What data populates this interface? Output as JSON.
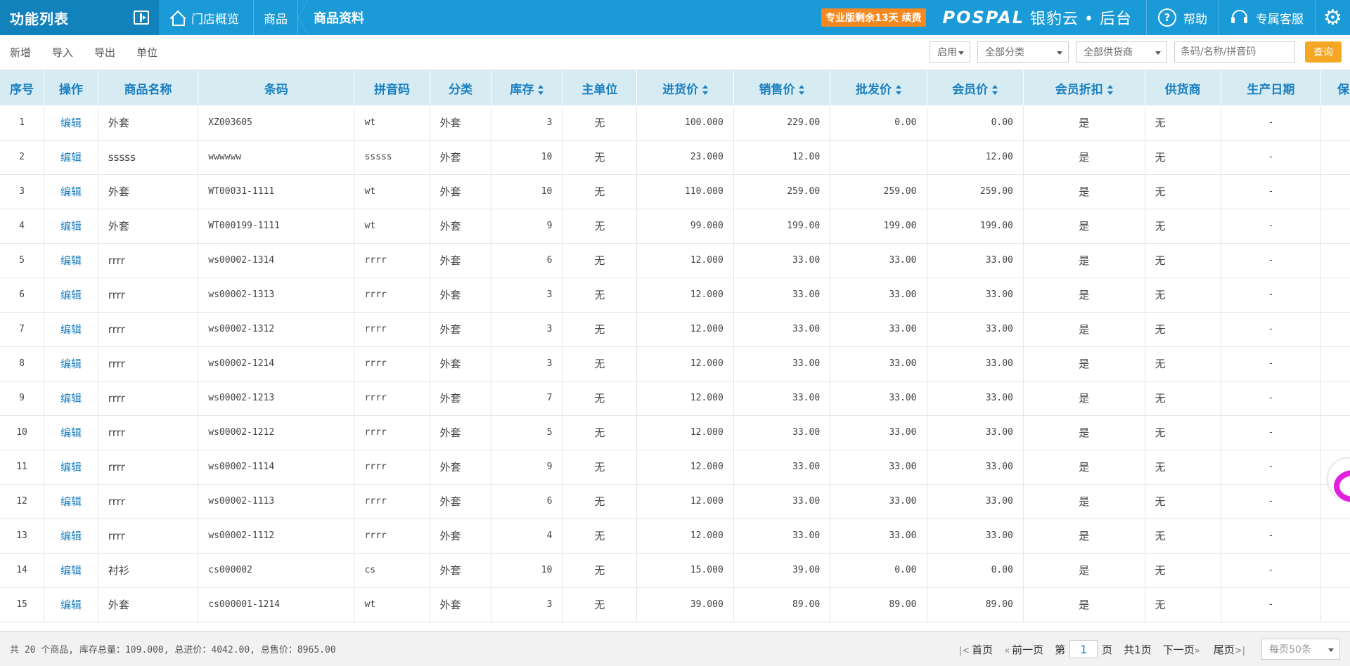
{
  "topbar": {
    "menu_title": "功能列表",
    "breadcrumb_home": "门店概览",
    "breadcrumb_parent": "商品",
    "breadcrumb_current": "商品资料",
    "renew_text": "专业版剩余13天 续费",
    "logo_text": "POSPAL",
    "logo_cn": "银豹云 • 后台",
    "help_label": "帮助",
    "service_label": "专属客服",
    "colors": {
      "bar": "#1a9ad6",
      "brand_block": "#1282bd",
      "renew": "#f5891f"
    }
  },
  "toolbar": {
    "actions": [
      "新增",
      "导入",
      "导出",
      "单位"
    ],
    "status_select": "启用",
    "category_select": "全部分类",
    "supplier_select": "全部供货商",
    "search_placeholder": "条码/名称/拼音码",
    "query_label": "查询",
    "colors": {
      "query": "#f5a623"
    }
  },
  "table": {
    "headers": [
      "序号",
      "操作",
      "商品名称",
      "条码",
      "拼音码",
      "分类",
      "库存",
      "主单位",
      "进货价",
      "销售价",
      "批发价",
      "会员价",
      "会员折扣",
      "供货商",
      "生产日期",
      "保质"
    ],
    "sortable": [
      "库存",
      "进货价",
      "销售价",
      "批发价",
      "会员价",
      "会员折扣"
    ],
    "edit_label": "编辑",
    "rows": [
      {
        "no": "1",
        "name": "外套",
        "barcode": "XZ003605",
        "pinyin": "wt",
        "category": "外套",
        "stock": "3",
        "unit": "无",
        "purchase": "100.000",
        "sale": "229.00",
        "wholesale": "0.00",
        "member": "0.00",
        "discount": "是",
        "supplier": "无",
        "date": "-"
      },
      {
        "no": "2",
        "name": "sssss",
        "barcode": "wwwwww",
        "pinyin": "sssss",
        "category": "外套",
        "stock": "10",
        "unit": "无",
        "purchase": "23.000",
        "sale": "12.00",
        "wholesale": "",
        "member": "12.00",
        "discount": "是",
        "supplier": "无",
        "date": "-"
      },
      {
        "no": "3",
        "name": "外套",
        "barcode": "WT00031-1111",
        "pinyin": "wt",
        "category": "外套",
        "stock": "10",
        "unit": "无",
        "purchase": "110.000",
        "sale": "259.00",
        "wholesale": "259.00",
        "member": "259.00",
        "discount": "是",
        "supplier": "无",
        "date": "-"
      },
      {
        "no": "4",
        "name": "外套",
        "barcode": "WT000199-1111",
        "pinyin": "wt",
        "category": "外套",
        "stock": "9",
        "unit": "无",
        "purchase": "99.000",
        "sale": "199.00",
        "wholesale": "199.00",
        "member": "199.00",
        "discount": "是",
        "supplier": "无",
        "date": "-"
      },
      {
        "no": "5",
        "name": "rrrr",
        "barcode": "ws00002-1314",
        "pinyin": "rrrr",
        "category": "外套",
        "stock": "6",
        "unit": "无",
        "purchase": "12.000",
        "sale": "33.00",
        "wholesale": "33.00",
        "member": "33.00",
        "discount": "是",
        "supplier": "无",
        "date": "-"
      },
      {
        "no": "6",
        "name": "rrrr",
        "barcode": "ws00002-1313",
        "pinyin": "rrrr",
        "category": "外套",
        "stock": "3",
        "unit": "无",
        "purchase": "12.000",
        "sale": "33.00",
        "wholesale": "33.00",
        "member": "33.00",
        "discount": "是",
        "supplier": "无",
        "date": "-"
      },
      {
        "no": "7",
        "name": "rrrr",
        "barcode": "ws00002-1312",
        "pinyin": "rrrr",
        "category": "外套",
        "stock": "3",
        "unit": "无",
        "purchase": "12.000",
        "sale": "33.00",
        "wholesale": "33.00",
        "member": "33.00",
        "discount": "是",
        "supplier": "无",
        "date": "-"
      },
      {
        "no": "8",
        "name": "rrrr",
        "barcode": "ws00002-1214",
        "pinyin": "rrrr",
        "category": "外套",
        "stock": "3",
        "unit": "无",
        "purchase": "12.000",
        "sale": "33.00",
        "wholesale": "33.00",
        "member": "33.00",
        "discount": "是",
        "supplier": "无",
        "date": "-"
      },
      {
        "no": "9",
        "name": "rrrr",
        "barcode": "ws00002-1213",
        "pinyin": "rrrr",
        "category": "外套",
        "stock": "7",
        "unit": "无",
        "purchase": "12.000",
        "sale": "33.00",
        "wholesale": "33.00",
        "member": "33.00",
        "discount": "是",
        "supplier": "无",
        "date": "-"
      },
      {
        "no": "10",
        "name": "rrrr",
        "barcode": "ws00002-1212",
        "pinyin": "rrrr",
        "category": "外套",
        "stock": "5",
        "unit": "无",
        "purchase": "12.000",
        "sale": "33.00",
        "wholesale": "33.00",
        "member": "33.00",
        "discount": "是",
        "supplier": "无",
        "date": "-"
      },
      {
        "no": "11",
        "name": "rrrr",
        "barcode": "ws00002-1114",
        "pinyin": "rrrr",
        "category": "外套",
        "stock": "9",
        "unit": "无",
        "purchase": "12.000",
        "sale": "33.00",
        "wholesale": "33.00",
        "member": "33.00",
        "discount": "是",
        "supplier": "无",
        "date": "-"
      },
      {
        "no": "12",
        "name": "rrrr",
        "barcode": "ws00002-1113",
        "pinyin": "rrrr",
        "category": "外套",
        "stock": "6",
        "unit": "无",
        "purchase": "12.000",
        "sale": "33.00",
        "wholesale": "33.00",
        "member": "33.00",
        "discount": "是",
        "supplier": "无",
        "date": "-"
      },
      {
        "no": "13",
        "name": "rrrr",
        "barcode": "ws00002-1112",
        "pinyin": "rrrr",
        "category": "外套",
        "stock": "4",
        "unit": "无",
        "purchase": "12.000",
        "sale": "33.00",
        "wholesale": "33.00",
        "member": "33.00",
        "discount": "是",
        "supplier": "无",
        "date": "-"
      },
      {
        "no": "14",
        "name": "衬衫",
        "barcode": "cs000002",
        "pinyin": "cs",
        "category": "外套",
        "stock": "10",
        "unit": "无",
        "purchase": "15.000",
        "sale": "39.00",
        "wholesale": "0.00",
        "member": "0.00",
        "discount": "是",
        "supplier": "无",
        "date": "-"
      },
      {
        "no": "15",
        "name": "外套",
        "barcode": "cs000001-1214",
        "pinyin": "wt",
        "category": "外套",
        "stock": "3",
        "unit": "无",
        "purchase": "39.000",
        "sale": "89.00",
        "wholesale": "89.00",
        "member": "89.00",
        "discount": "是",
        "supplier": "无",
        "date": "-"
      }
    ]
  },
  "footer": {
    "summary": "共 20 个商品, 库存总量：109.000, 总进价：4042.00, 总售价：8965.00",
    "first": "首页",
    "prev": "前一页",
    "page_prefix": "第",
    "page_value": "1",
    "page_suffix": "页",
    "total_pages": "共1页",
    "next": "下一页",
    "last": "尾页",
    "per_page": "每页50条"
  }
}
